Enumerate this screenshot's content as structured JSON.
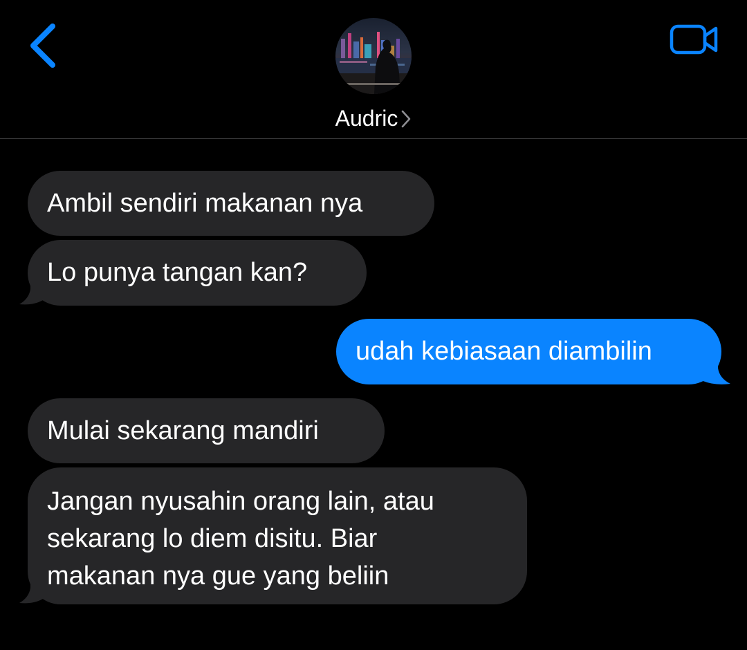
{
  "header": {
    "contact_name": "Audric",
    "colors": {
      "accent": "#0A84FF",
      "background": "#000000",
      "incoming_bubble": "#262628",
      "outgoing_bubble": "#0A84FF"
    },
    "icons": {
      "back": "chevron-left-icon",
      "video_call": "video-camera-icon",
      "name_chevron": "chevron-right-icon"
    }
  },
  "messages": [
    {
      "sender": "contact",
      "text": "Ambil sendiri makanan nya"
    },
    {
      "sender": "contact",
      "text": "Lo punya tangan kan?"
    },
    {
      "sender": "me",
      "text": "udah kebiasaan diambilin"
    },
    {
      "sender": "contact",
      "text": "Mulai sekarang mandiri"
    },
    {
      "sender": "contact",
      "lines": [
        "Jangan nyusahin orang lain, atau",
        "sekarang lo diem disitu. Biar",
        "makanan nya gue yang beliin"
      ]
    }
  ]
}
